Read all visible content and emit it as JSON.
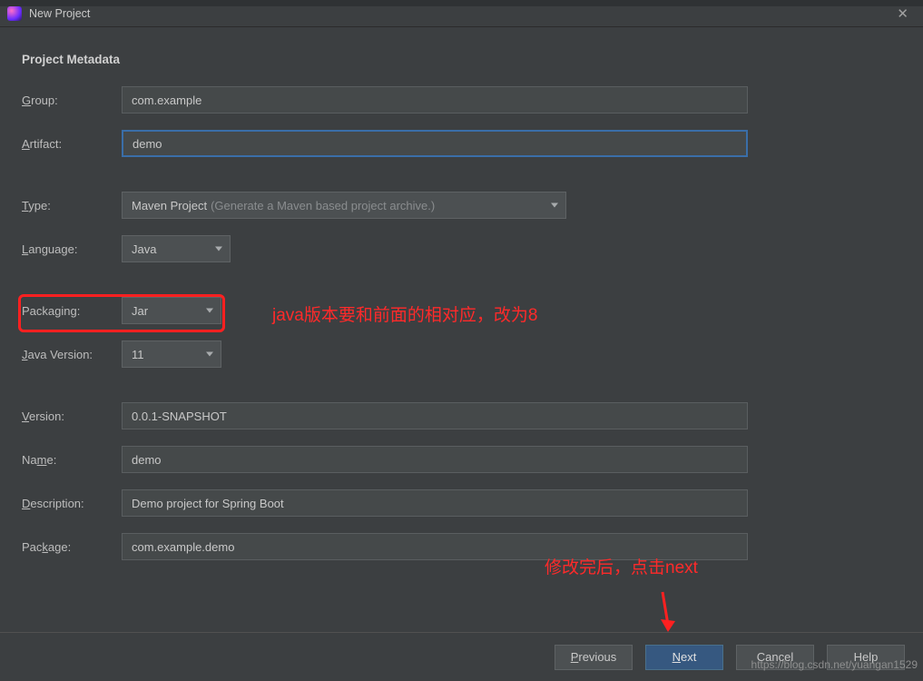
{
  "window": {
    "title": "New Project"
  },
  "heading": "Project Metadata",
  "labels": {
    "group": "Group:",
    "artifact": "Artifact:",
    "type": "Type:",
    "language": "Language:",
    "packaging": "Packaging:",
    "javaVersion": "Java Version:",
    "version": "Version:",
    "name": "Name:",
    "description": "Description:",
    "package": "Package:"
  },
  "fields": {
    "group": "com.example",
    "artifact": "demo",
    "type": "Maven Project",
    "typeHint": "(Generate a Maven based project archive.)",
    "language": "Java",
    "packaging": "Jar",
    "javaVersion": "11",
    "version": "0.0.1-SNAPSHOT",
    "name": "demo",
    "description": "Demo project for Spring Boot",
    "package": "com.example.demo"
  },
  "annotations": {
    "line1": "java版本要和前面的相对应，改为8",
    "line2": "修改完后，点击next"
  },
  "buttons": {
    "previous": "Previous",
    "next": "Next",
    "cancel": "Cancel",
    "help": "Help"
  },
  "watermark": "https://blog.csdn.net/yuangan1529"
}
